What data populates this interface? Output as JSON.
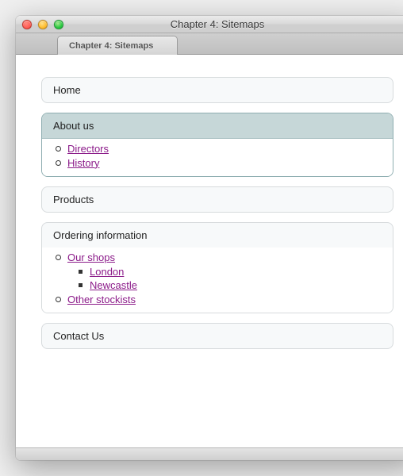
{
  "window": {
    "title": "Chapter 4: Sitemaps",
    "tab_label": "Chapter 4: Sitemaps"
  },
  "sitemap": {
    "home": {
      "label": "Home"
    },
    "about": {
      "label": "About us",
      "items": [
        {
          "label": "Directors"
        },
        {
          "label": "History"
        }
      ]
    },
    "products": {
      "label": "Products"
    },
    "ordering": {
      "label": "Ordering information",
      "items": [
        {
          "label": "Our shops",
          "children": [
            {
              "label": "London"
            },
            {
              "label": "Newcastle"
            }
          ]
        },
        {
          "label": "Other stockists"
        }
      ]
    },
    "contact": {
      "label": "Contact Us"
    }
  }
}
